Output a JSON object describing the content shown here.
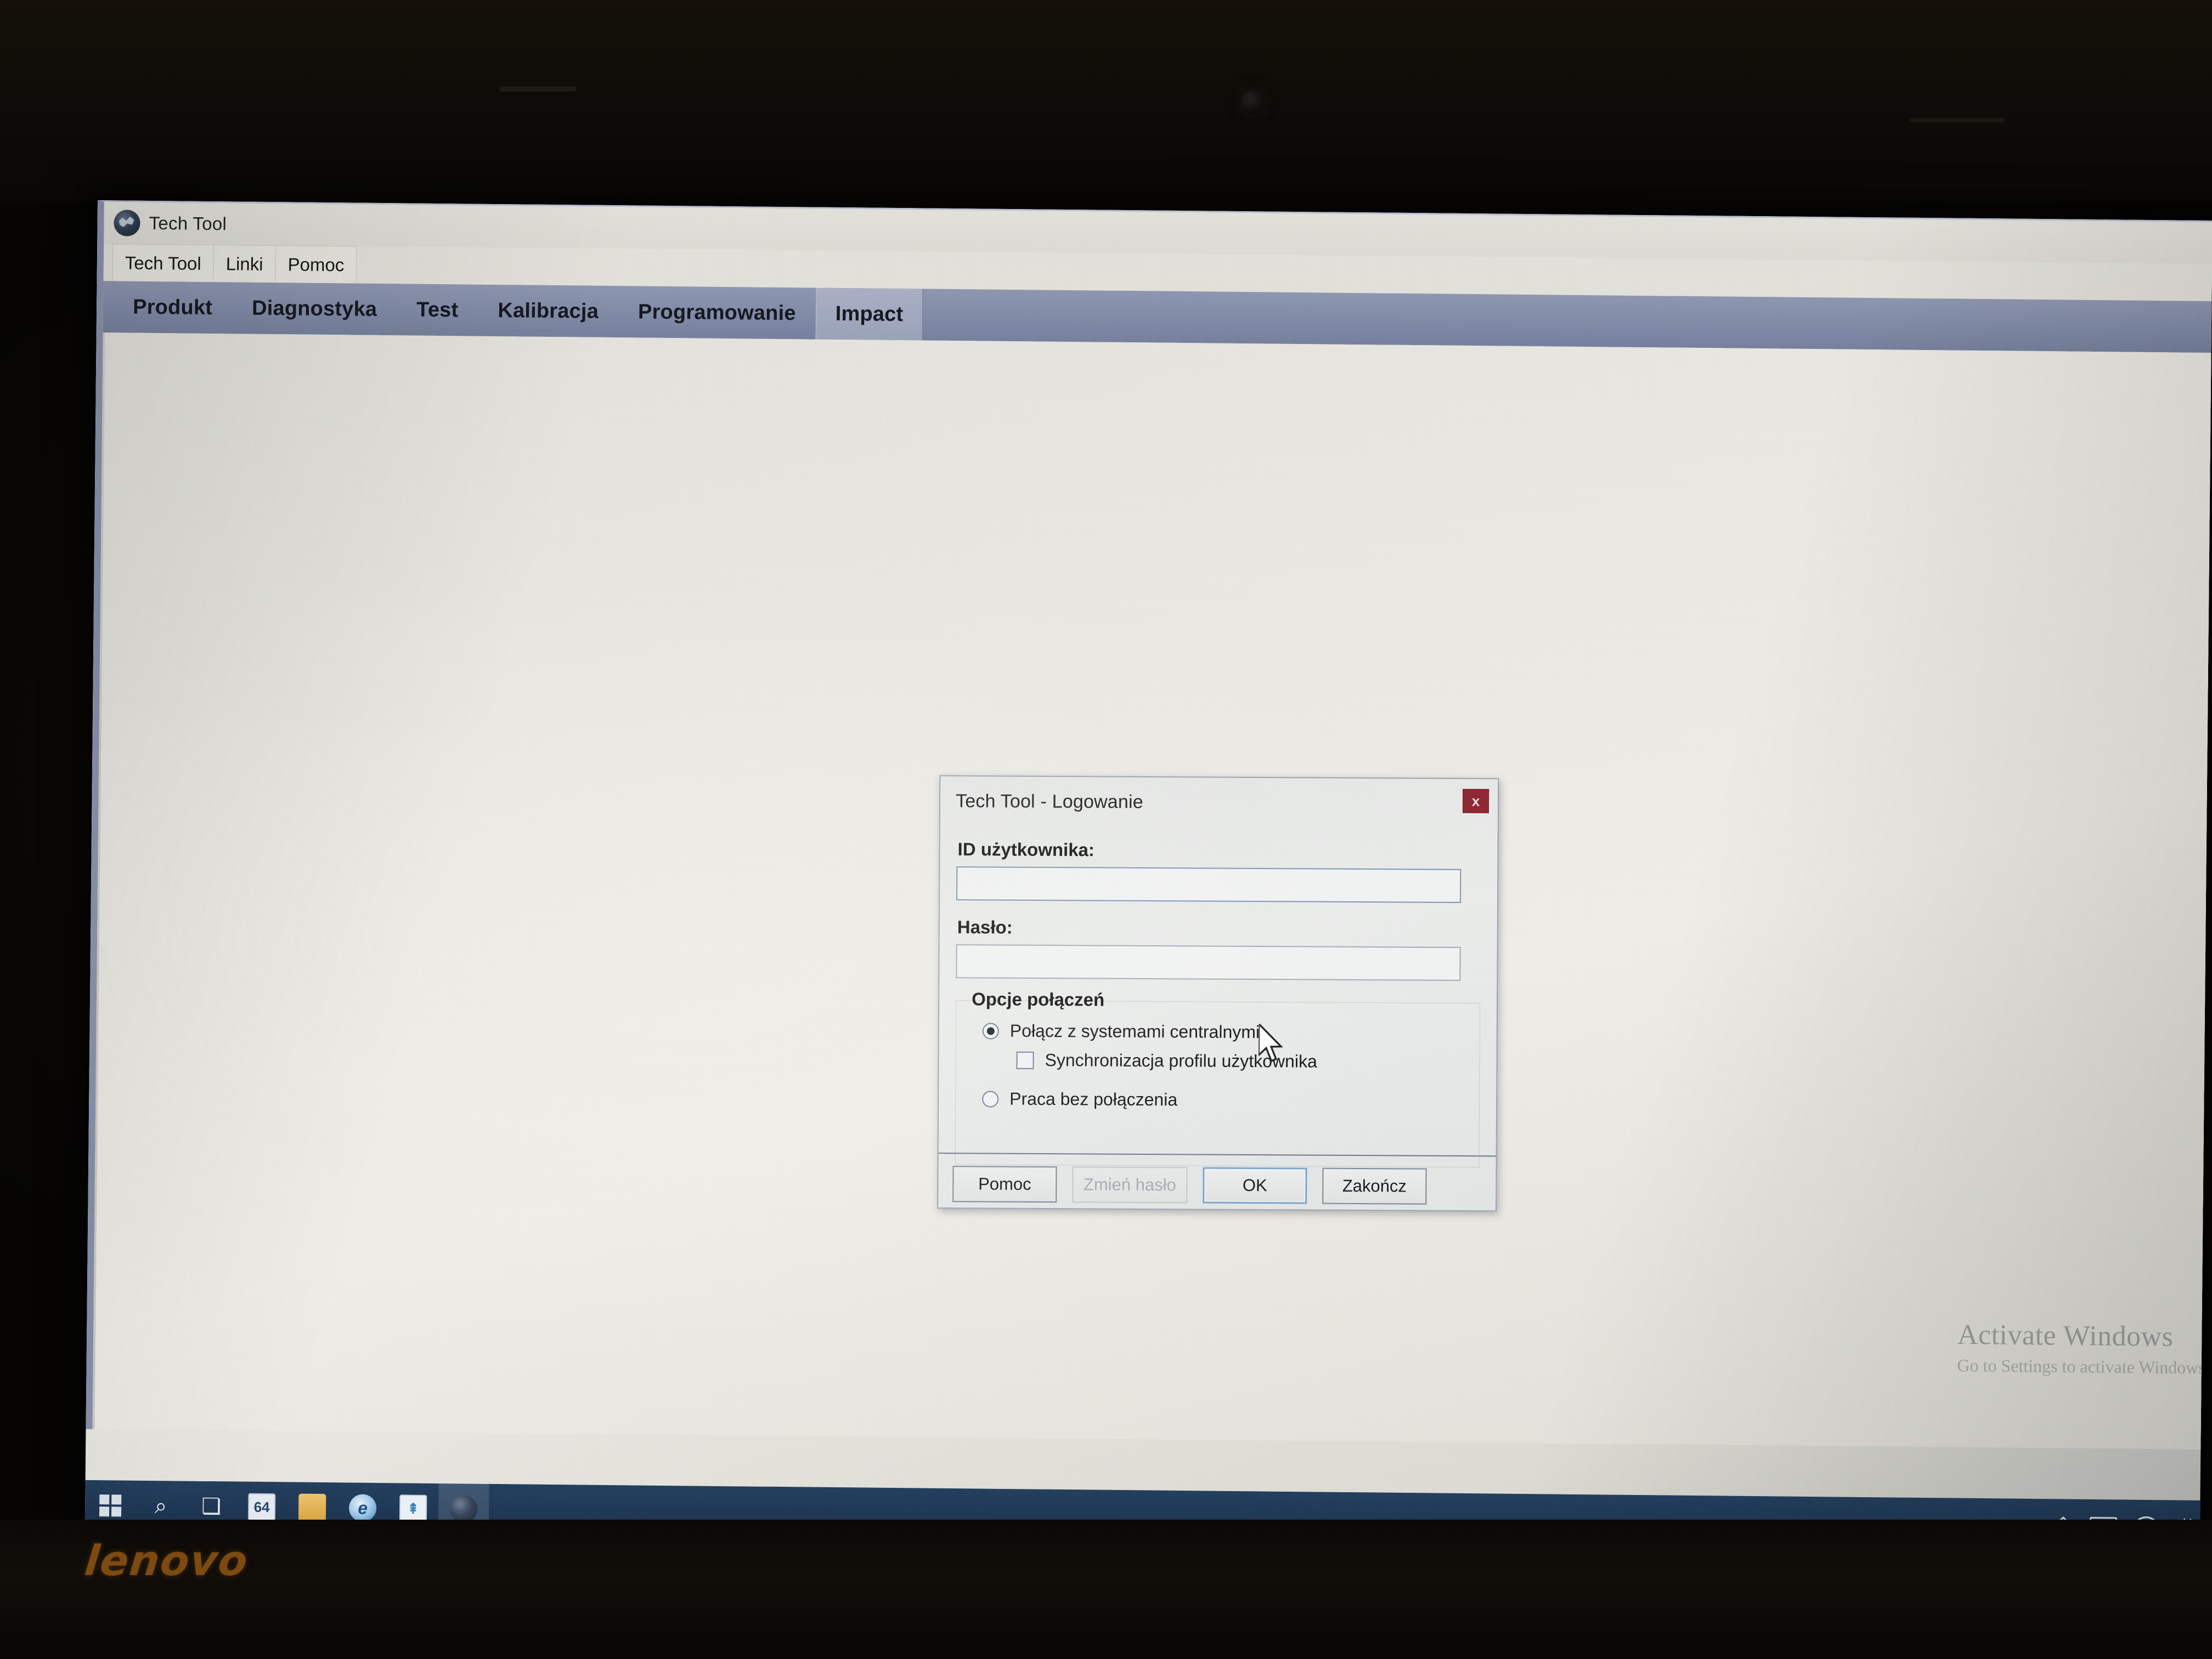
{
  "device": {
    "brand_logo": "lenovo",
    "webcam_icon": "webcam-icon"
  },
  "app": {
    "title": "Tech Tool",
    "icon": "tech-tool-globe-icon",
    "menu": [
      {
        "label": "Tech Tool"
      },
      {
        "label": "Linki"
      },
      {
        "label": "Pomoc"
      }
    ],
    "tabs": [
      {
        "label": "Produkt",
        "active": false
      },
      {
        "label": "Diagnostyka",
        "active": false
      },
      {
        "label": "Test",
        "active": false
      },
      {
        "label": "Kalibracja",
        "active": false
      },
      {
        "label": "Programowanie",
        "active": false
      },
      {
        "label": "Impact",
        "active": true
      }
    ]
  },
  "dialog": {
    "title": "Tech Tool - Logowanie",
    "close_label": "x",
    "user_id": {
      "label": "ID użytkownika:",
      "value": "",
      "placeholder": "",
      "focused": true
    },
    "password": {
      "label": "Hasło:",
      "value": "",
      "placeholder": "",
      "focused": false
    },
    "connection_group": {
      "title": "Opcje połączeń",
      "options": [
        {
          "label": "Połącz z systemami centralnymi",
          "type": "radio",
          "checked": true
        },
        {
          "label": "Synchronizacja profilu użytkownika",
          "type": "checkbox",
          "checked": false
        },
        {
          "label": "Praca bez połączenia",
          "type": "radio",
          "checked": false
        }
      ]
    },
    "buttons": [
      {
        "label": "Pomoc",
        "state": "enabled"
      },
      {
        "label": "Zmień hasło",
        "state": "disabled"
      },
      {
        "label": "OK",
        "state": "focused"
      },
      {
        "label": "Zakończ",
        "state": "enabled"
      }
    ]
  },
  "watermark": {
    "line1": "Activate Windows",
    "line2": "Go to Settings to activate Windows"
  },
  "taskbar": {
    "start_label": "start-button",
    "search_glyph": "⌕",
    "taskview_glyph": "❏",
    "apps": [
      {
        "name": "calculator",
        "glyph": "64"
      },
      {
        "name": "file-explorer",
        "glyph": ""
      },
      {
        "name": "internet-explorer",
        "glyph": "e"
      },
      {
        "name": "blue-app",
        "glyph": "⇞"
      },
      {
        "name": "tech-tool",
        "glyph": ""
      }
    ],
    "tray": {
      "chevron": "⌃",
      "battery": "battery-icon",
      "wifi": "wifi-icon",
      "volume": "🔊"
    }
  },
  "colors": {
    "tab_bar": "#7f89a6",
    "close_button": "#8d2430",
    "taskbar": "#1a3352",
    "focus_border": "#7ba6cf",
    "lenovo_orange": "#7d4a10"
  }
}
